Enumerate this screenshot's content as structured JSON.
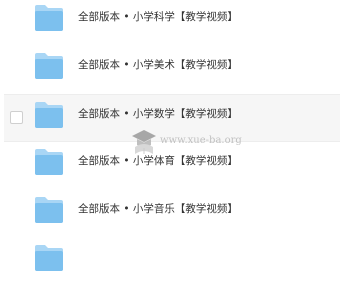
{
  "folders": [
    {
      "name": "全部版本 • 小学科学【教学视频】",
      "icon": "folder-icon",
      "hovered": false
    },
    {
      "name": "全部版本 • 小学美术【教学视频】",
      "icon": "folder-icon",
      "hovered": false
    },
    {
      "name": "全部版本 • 小学数学【教学视频】",
      "icon": "folder-icon",
      "hovered": true
    },
    {
      "name": "全部版本 • 小学体育【教学视频】",
      "icon": "folder-icon",
      "hovered": false
    },
    {
      "name": "全部版本 • 小学音乐【教学视频】",
      "icon": "folder-icon",
      "hovered": false
    },
    {
      "name": "",
      "icon": "folder-icon",
      "hovered": false
    }
  ],
  "watermark": {
    "text": "www.xue-ba.org",
    "icon": "graduation-cap-icon"
  },
  "colors": {
    "folder_light": "#a9d6f5",
    "folder_main": "#7cc0ee",
    "hover_background": "#f6f6f6",
    "text": "#333333"
  }
}
